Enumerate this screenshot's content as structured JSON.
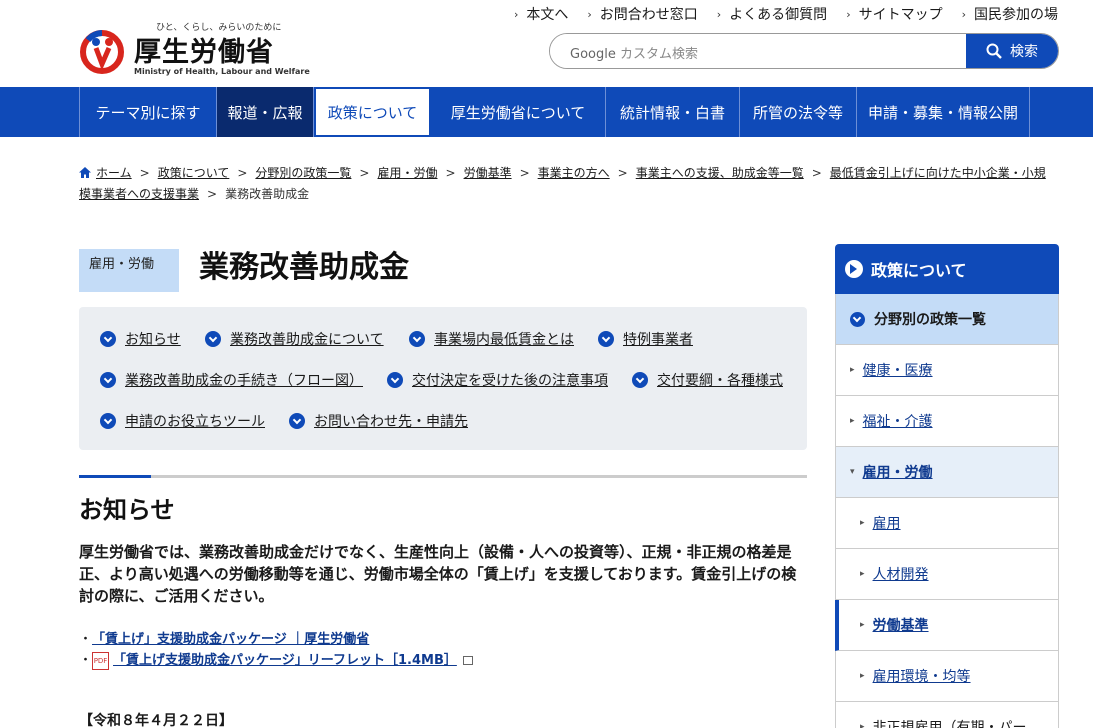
{
  "header": {
    "tagline": "ひと、くらし、みらいのために",
    "site_name": "厚生労働省",
    "site_name_en": "Ministry of Health, Labour and Welfare",
    "util_links": [
      "本文へ",
      "お問合わせ窓口",
      "よくある御質問",
      "サイトマップ",
      "国民参加の場"
    ],
    "search_brand": "Google",
    "search_placeholder": "カスタム検索",
    "search_button": "検索"
  },
  "nav": [
    "テーマ別に探す",
    "報道・広報",
    "政策について",
    "厚生労働省について",
    "統計情報・白書",
    "所管の法令等",
    "申請・募集・情報公開"
  ],
  "breadcrumb": [
    "ホーム",
    "政策について",
    "分野別の政策一覧",
    "雇用・労働",
    "労働基準",
    "事業主の方へ",
    "事業主への支援、助成金等一覧",
    "最低賃金引上げに向けた中小企業・小規模事業者への支援事業",
    "業務改善助成金"
  ],
  "page": {
    "tag": "雇用・労働",
    "title": "業務改善助成金"
  },
  "anchors": [
    "お知らせ",
    "業務改善助成金について",
    "事業場内最低賃金とは",
    "特例事業者",
    "業務改善助成金の手続き（フロー図）",
    "交付決定を受けた後の注意事項",
    "交付要綱・各種様式",
    "申請のお役立ちツール",
    "お問い合わせ先・申請先"
  ],
  "section": {
    "heading": "お知らせ",
    "body": "厚生労働省では、業務改善助成金だけでなく、生産性向上（設備・人への投資等）、正規・非正規の格差是正、より高い処遇への労働移動等を通じ、労働市場全体の「賃上げ」を支援しております。賃金引上げの検討の際に、ご活用ください。",
    "links": [
      "「賃上げ」支援助成金パッケージ ｜厚生労働省",
      "「賃上げ支援助成金パッケージ」リーフレット［1.4MB］"
    ],
    "pdf_label": "PDF",
    "date": "【令和８年４月２２日】"
  },
  "sidebar": {
    "title": "政策について",
    "items": [
      {
        "label": "分野別の政策一覧",
        "level": 1
      },
      {
        "label": "健康・医療",
        "level": 2
      },
      {
        "label": "福祉・介護",
        "level": 2
      },
      {
        "label": "雇用・労働",
        "level": 2
      },
      {
        "label": "雇用",
        "level": 3
      },
      {
        "label": "人材開発",
        "level": 3
      },
      {
        "label": "労働基準",
        "level": 3
      },
      {
        "label": "雇用環境・均等",
        "level": 3
      },
      {
        "label": "非正規雇用（有期・パー",
        "level": 3
      }
    ]
  },
  "colors": {
    "primary": "#0f4ab8",
    "nav_dark": "#0a2a6e",
    "light_blue": "#c4dcf7"
  }
}
